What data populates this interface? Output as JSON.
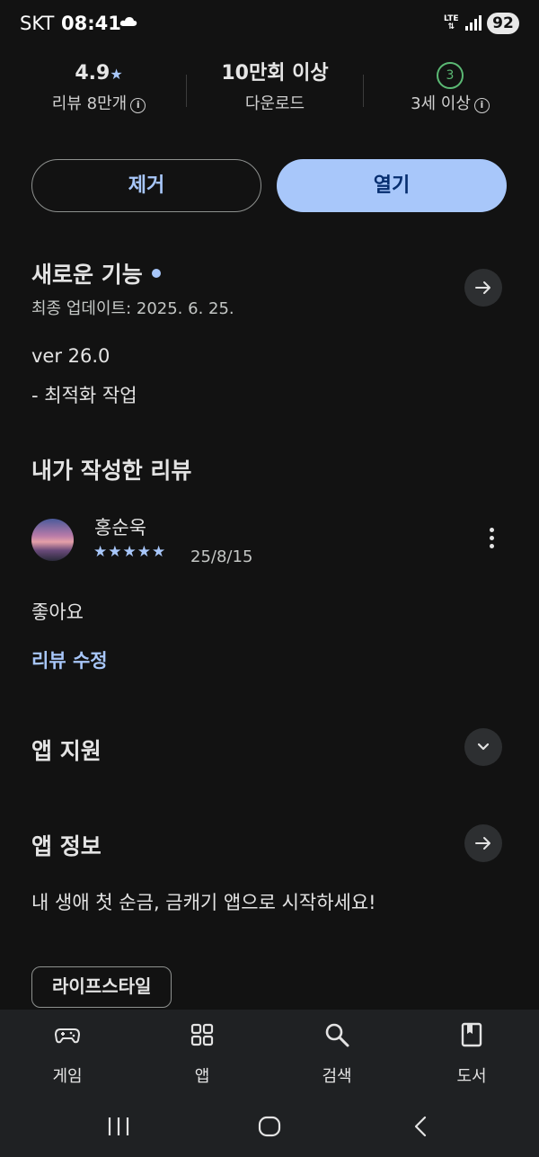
{
  "status_bar": {
    "carrier": "SKT",
    "time": "08:41",
    "network": "LTE",
    "battery": "92"
  },
  "stats": {
    "rating": "4.9",
    "reviews_label": "리뷰 8만개",
    "downloads": "10만회 이상",
    "downloads_label": "다운로드",
    "age_badge": "3",
    "age_label": "3세 이상"
  },
  "actions": {
    "remove_label": "제거",
    "open_label": "열기"
  },
  "whats_new": {
    "title": "새로운 기능",
    "updated": "최종 업데이트: 2025. 6. 25.",
    "version": "ver 26.0",
    "notes": "- 최적화 작업"
  },
  "my_review": {
    "title": "내가 작성한 리뷰",
    "reviewer": "홍순욱",
    "stars": "★★★★★",
    "rating": 5,
    "date": "25/8/15",
    "text": "좋아요",
    "edit_label": "리뷰 수정"
  },
  "app_support": {
    "title": "앱 지원"
  },
  "app_info": {
    "title": "앱 정보",
    "description": "내 생애 첫 순금, 금캐기 앱으로 시작하세요!",
    "category_chip": "라이프스타일"
  },
  "bottom_nav": {
    "items": [
      {
        "label": "게임",
        "icon": "gamepad-icon"
      },
      {
        "label": "앱",
        "icon": "apps-grid-icon"
      },
      {
        "label": "검색",
        "icon": "search-icon"
      },
      {
        "label": "도서",
        "icon": "book-icon"
      }
    ]
  },
  "colors": {
    "background": "#121212",
    "accent": "#a8c7fa",
    "age_green": "#5bb974"
  }
}
